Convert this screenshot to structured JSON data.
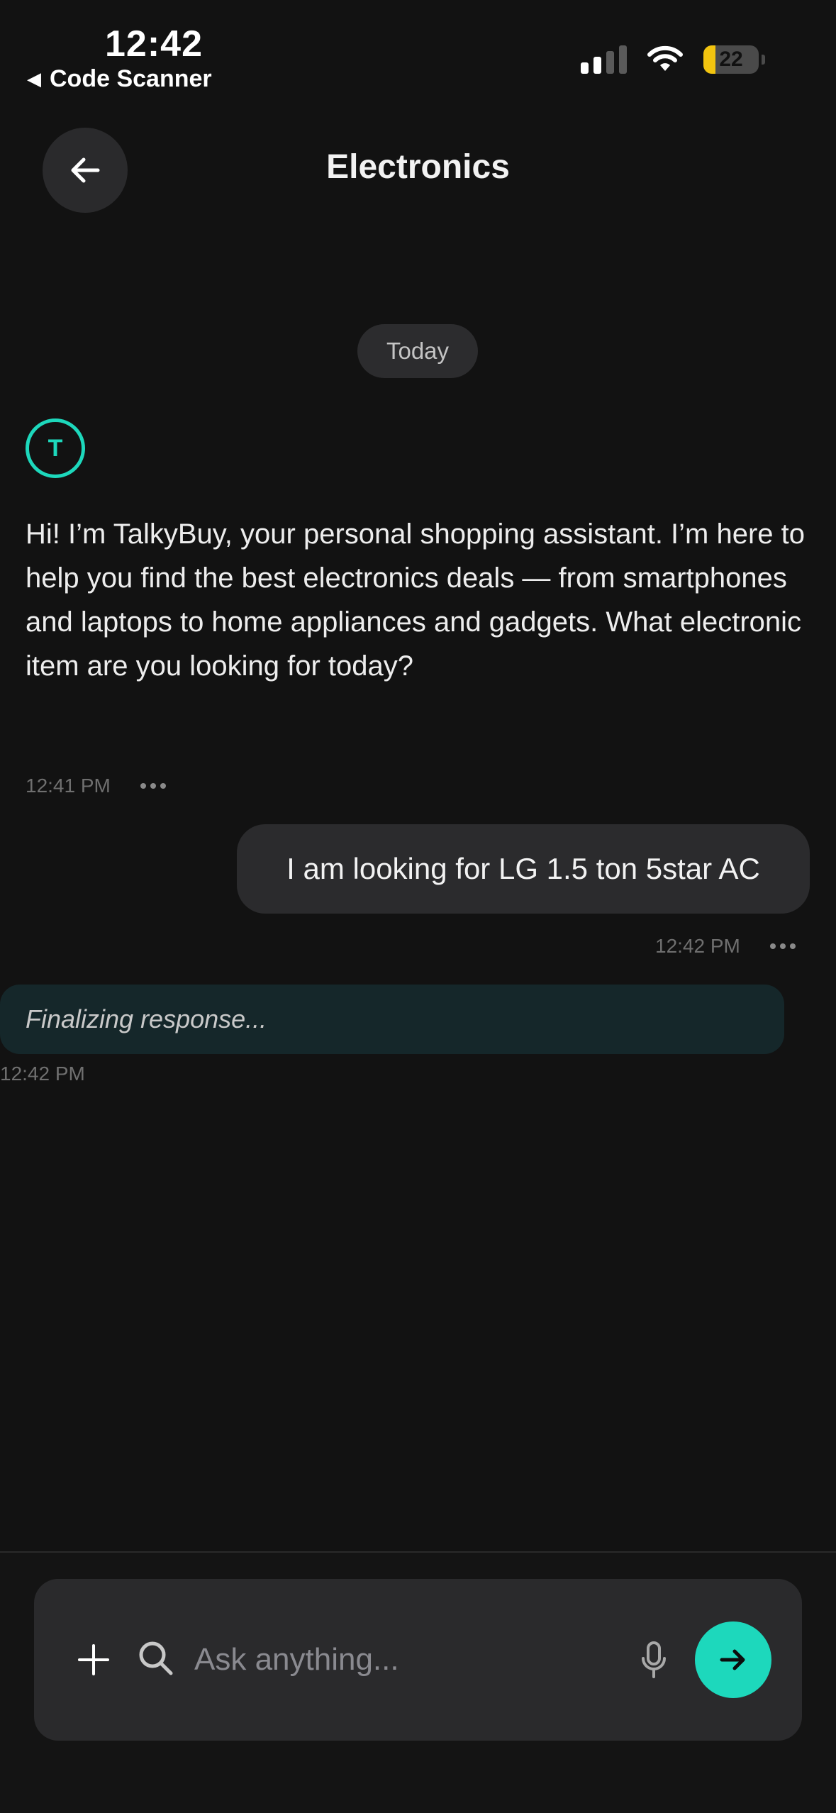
{
  "status_bar": {
    "time": "12:42",
    "back_app": "Code Scanner",
    "battery": "22",
    "battery_level": 0.22
  },
  "header": {
    "title": "Electronics"
  },
  "chat": {
    "date_divider": "Today",
    "bot_avatar_letter": "T",
    "bot_message": "Hi! I’m TalkyBuy, your personal shopping assistant. I’m here to help you find the best electronics deals — from smartphones and laptops to home appliances and gadgets. What electronic item are you looking for today?",
    "bot_time": "12:41 PM",
    "user_message": "I am looking for LG 1.5 ton 5star AC",
    "user_time": "12:42 PM",
    "status_message": "Finalizing response...",
    "status_time": "12:42 PM"
  },
  "composer": {
    "placeholder": "Ask anything..."
  },
  "colors": {
    "accent": "#1dd8bc",
    "background": "#121212",
    "bubble": "#2b2b2d",
    "status_bubble": "#15272a"
  },
  "icons": [
    "back-arrow-icon",
    "signal-icon",
    "wifi-icon",
    "battery-icon",
    "plus-icon",
    "search-icon",
    "mic-icon",
    "send-arrow-icon",
    "more-dots-icon"
  ]
}
